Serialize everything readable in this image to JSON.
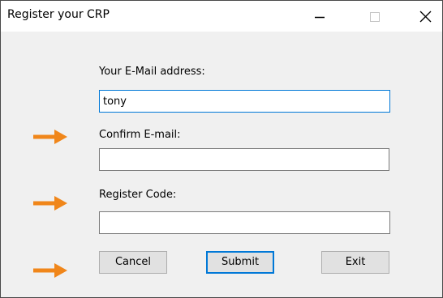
{
  "window": {
    "title": "Register your CRP",
    "controls": [
      "minimize-icon",
      "maximize-icon",
      "close-icon"
    ]
  },
  "form": {
    "email_label": "Your E-Mail address:",
    "email_value": "tony",
    "confirm_label": "Confirm E-mail:",
    "confirm_value": "",
    "code_label": "Register Code:",
    "code_value": ""
  },
  "buttons": {
    "cancel": "Cancel",
    "submit": "Submit",
    "exit": "Exit"
  },
  "annotations": {
    "arrow_color": "#f0861a",
    "arrow_count": 3
  },
  "colors": {
    "focus_border": "#0078d7",
    "window_bg": "#f0f0f0"
  }
}
